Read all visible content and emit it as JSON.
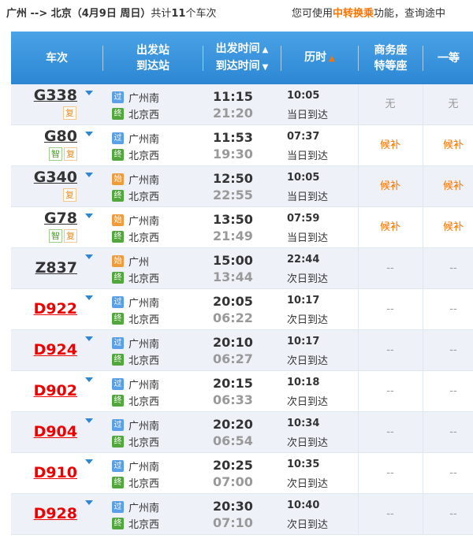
{
  "summary": {
    "route_prefix": "广州 --> 北京（4月9日  周日）",
    "count_prefix": "共计",
    "count": "11",
    "count_suffix": "个车次"
  },
  "tip": {
    "prefix": "您可使用",
    "highlight": "中转换乘",
    "suffix": "功能，查询途中"
  },
  "header": {
    "train": "车次",
    "from": "出发站",
    "to": "到达站",
    "dep_time": "出发时间",
    "arr_time": "到达时间",
    "duration": "历时",
    "business": "商务座",
    "special": "特等座",
    "first": "一等"
  },
  "icons": {
    "guo": "过",
    "shi": "始",
    "zhong": "终",
    "zhi": "智",
    "fu": "复"
  },
  "rows": [
    {
      "no": "G338",
      "type": "g",
      "badges": [
        "复"
      ],
      "from_icon": "过",
      "from": "广州南",
      "to": "北京西",
      "dep": "11:15",
      "arr": "21:20",
      "dur": "10:05",
      "day": "当日到达",
      "bus": "无",
      "first": "无",
      "bus_kind": "wu",
      "first_kind": "wu"
    },
    {
      "no": "G80",
      "type": "g",
      "badges": [
        "智",
        "复"
      ],
      "from_icon": "过",
      "from": "广州南",
      "to": "北京西",
      "dep": "11:53",
      "arr": "19:30",
      "dur": "07:37",
      "day": "当日到达",
      "bus": "候补",
      "first": "候补",
      "bus_kind": "hb",
      "first_kind": "hb"
    },
    {
      "no": "G340",
      "type": "g",
      "badges": [
        "复"
      ],
      "from_icon": "始",
      "from": "广州南",
      "to": "北京西",
      "dep": "12:50",
      "arr": "22:55",
      "dur": "10:05",
      "day": "当日到达",
      "bus": "候补",
      "first": "候补",
      "bus_kind": "hb",
      "first_kind": "hb"
    },
    {
      "no": "G78",
      "type": "g",
      "badges": [
        "智",
        "复"
      ],
      "from_icon": "始",
      "from": "广州南",
      "to": "北京西",
      "dep": "13:50",
      "arr": "21:49",
      "dur": "07:59",
      "day": "当日到达",
      "bus": "候补",
      "first": "候补",
      "bus_kind": "hb",
      "first_kind": "hb"
    },
    {
      "no": "Z837",
      "type": "g",
      "badges": [],
      "from_icon": "始",
      "from": "广州",
      "to": "北京西",
      "dep": "15:00",
      "arr": "13:44",
      "dur": "22:44",
      "day": "次日到达",
      "bus": "--",
      "first": "--",
      "bus_kind": "none",
      "first_kind": "none"
    },
    {
      "no": "D922",
      "type": "d",
      "badges": [],
      "from_icon": "过",
      "from": "广州南",
      "to": "北京西",
      "dep": "20:05",
      "arr": "06:22",
      "dur": "10:17",
      "day": "次日到达",
      "bus": "--",
      "first": "--",
      "bus_kind": "none",
      "first_kind": "none"
    },
    {
      "no": "D924",
      "type": "d",
      "badges": [],
      "from_icon": "过",
      "from": "广州南",
      "to": "北京西",
      "dep": "20:10",
      "arr": "06:27",
      "dur": "10:17",
      "day": "次日到达",
      "bus": "--",
      "first": "--",
      "bus_kind": "none",
      "first_kind": "none"
    },
    {
      "no": "D902",
      "type": "d",
      "badges": [],
      "from_icon": "过",
      "from": "广州南",
      "to": "北京西",
      "dep": "20:15",
      "arr": "06:33",
      "dur": "10:18",
      "day": "次日到达",
      "bus": "--",
      "first": "--",
      "bus_kind": "none",
      "first_kind": "none"
    },
    {
      "no": "D904",
      "type": "d",
      "badges": [],
      "from_icon": "过",
      "from": "广州南",
      "to": "北京西",
      "dep": "20:20",
      "arr": "06:54",
      "dur": "10:34",
      "day": "次日到达",
      "bus": "--",
      "first": "--",
      "bus_kind": "none",
      "first_kind": "none"
    },
    {
      "no": "D910",
      "type": "d",
      "badges": [],
      "from_icon": "过",
      "from": "广州南",
      "to": "北京西",
      "dep": "20:25",
      "arr": "07:00",
      "dur": "10:35",
      "day": "次日到达",
      "bus": "--",
      "first": "--",
      "bus_kind": "none",
      "first_kind": "none"
    },
    {
      "no": "D928",
      "type": "d",
      "badges": [],
      "from_icon": "过",
      "from": "广州南",
      "to": "北京西",
      "dep": "20:30",
      "arr": "07:10",
      "dur": "10:40",
      "day": "次日到达",
      "bus": "--",
      "first": "--",
      "bus_kind": "none",
      "first_kind": "none"
    }
  ],
  "colors": {
    "header_top": "#4aa3e6",
    "header_bottom": "#2c86d3",
    "accent_orange": "#fb7403",
    "d_train_red": "#e00000",
    "row_alt": "#eef2f8"
  }
}
